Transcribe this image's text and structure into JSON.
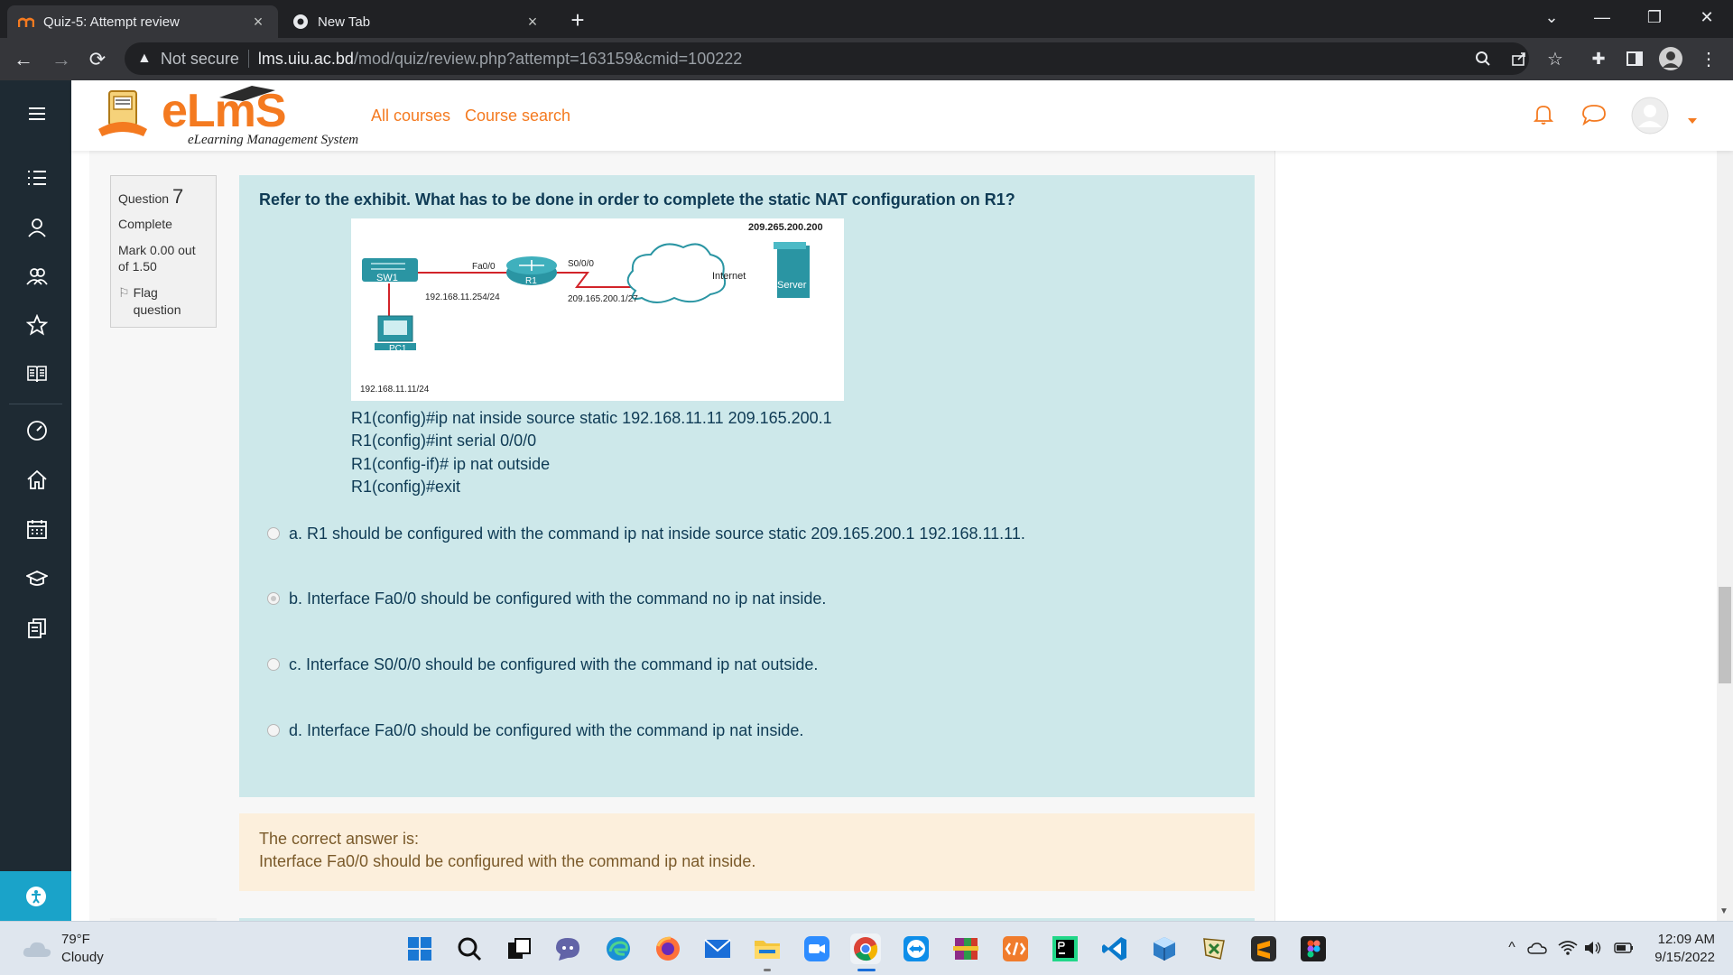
{
  "browser": {
    "tabs": [
      {
        "title": "Quiz-5: Attempt review",
        "active": true
      },
      {
        "title": "New Tab",
        "active": false
      }
    ],
    "address": {
      "security_label": "Not secure",
      "host": "lms.uiu.ac.bd",
      "path": "/mod/quiz/review.php?attempt=163159&cmid=100222"
    }
  },
  "header": {
    "logo_word": "eLmS",
    "logo_subtitle": "eLearning Management System",
    "nav": [
      "All courses",
      "Course search"
    ]
  },
  "question_info": {
    "label": "Question",
    "number": "7",
    "state": "Complete",
    "mark": "Mark 0.00 out of 1.50",
    "flag": "Flag question"
  },
  "question": {
    "text": "Refer to the exhibit. What has to be done in order to complete the static NAT configuration on R1?",
    "exhibit": {
      "server_ip": "209.265.200.200",
      "fa_label": "Fa0/0",
      "s_label": "S0/0/0",
      "sw_label": "SW1",
      "r_label": "R1",
      "cloud_label": "Internet",
      "server_label": "Server",
      "lan_ip": "192.168.11.254/24",
      "wan_ip": "209.165.200.1/27",
      "pc_label": "PC1",
      "pc_ip": "192.168.11.11/24"
    },
    "commands": [
      "R1(config)#ip nat inside source static 192.168.11.11 209.165.200.1",
      "R1(config)#int serial 0/0/0",
      "R1(config-if)# ip nat outside",
      "R1(config)#exit"
    ],
    "options": [
      {
        "text": "a. R1 should be configured with the command ip nat inside source static 209.165.200.1 192.168.11.11.",
        "selected": false
      },
      {
        "text": "b. Interface Fa0/0 should be configured with the command no ip nat inside.",
        "selected": true
      },
      {
        "text": "c. Interface S0/0/0 should be configured with the command ip nat outside.",
        "selected": false
      },
      {
        "text": "d. Interface Fa0/0 should be configured with the command ip nat inside.",
        "selected": false
      }
    ]
  },
  "feedback": {
    "heading": "The correct answer is:",
    "answer": "Interface Fa0/0 should be configured with the command ip nat inside."
  },
  "taskbar": {
    "weather_temp": "79°F",
    "weather_desc": "Cloudy",
    "time": "12:09 AM",
    "date": "9/15/2022"
  },
  "colors": {
    "accent": "#f47a20",
    "sidebar": "#1e2a33",
    "question_bg": "#cde8ea",
    "feedback_bg": "#fcefdc"
  }
}
